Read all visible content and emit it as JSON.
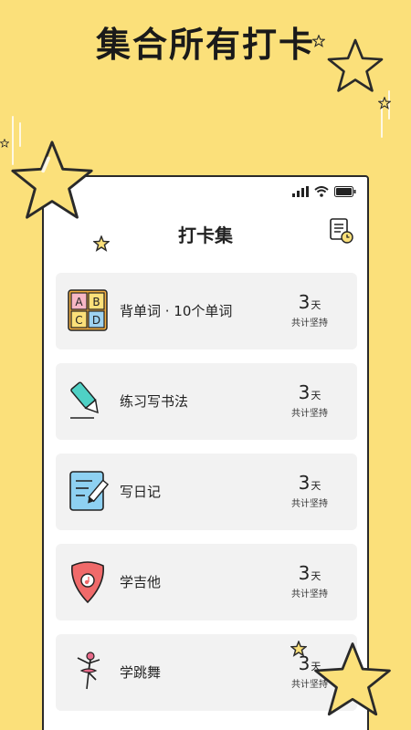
{
  "promo": {
    "headline": "集合所有打卡"
  },
  "app": {
    "title": "打卡集",
    "items": [
      {
        "label": "背单词 · 10个单词",
        "count": "3",
        "unit": "天",
        "caption": "共计坚持",
        "icon": "abcd-blocks-icon"
      },
      {
        "label": "练习写书法",
        "count": "3",
        "unit": "天",
        "caption": "共计坚持",
        "icon": "brush-pen-icon"
      },
      {
        "label": "写日记",
        "count": "3",
        "unit": "天",
        "caption": "共计坚持",
        "icon": "notebook-pencil-icon"
      },
      {
        "label": "学吉他",
        "count": "3",
        "unit": "天",
        "caption": "共计坚持",
        "icon": "guitar-pick-icon"
      },
      {
        "label": "学跳舞",
        "count": "3",
        "unit": "天",
        "caption": "共计坚持",
        "icon": "ballerina-icon"
      }
    ]
  },
  "colors": {
    "background": "#FBE07A",
    "card": "#F2F2F2",
    "star": "#FBE07A",
    "accent_teal": "#4FD1C5",
    "accent_red": "#F06A6A"
  }
}
